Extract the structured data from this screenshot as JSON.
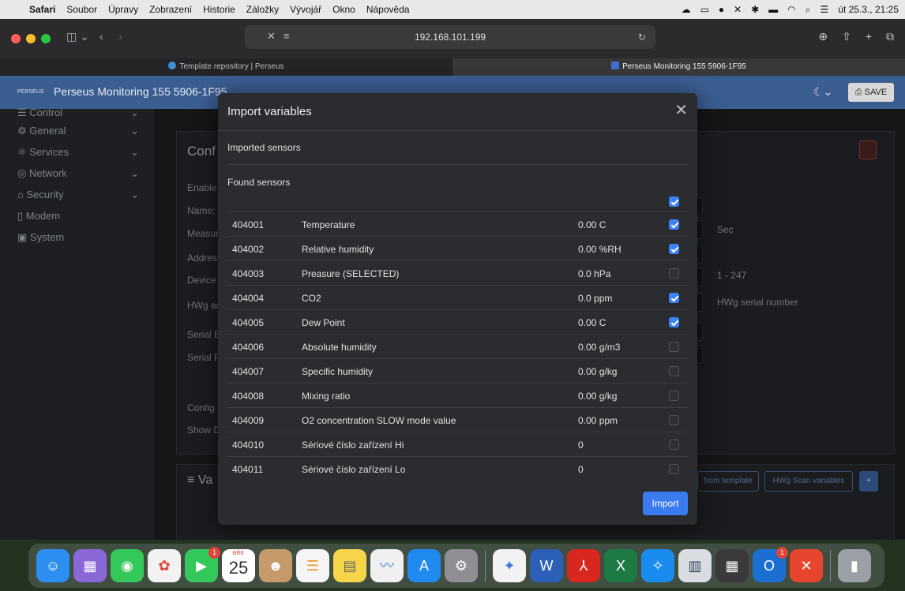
{
  "menubar": {
    "app": "Safari",
    "items": [
      "Soubor",
      "Úpravy",
      "Zobrazení",
      "Historie",
      "Záložky",
      "Vývojář",
      "Okno",
      "Nápověda"
    ],
    "datetime": "út 25.3., 21:25"
  },
  "browser": {
    "url": "192.168.101.199",
    "tabs": [
      {
        "label": "Template repository | Perseus"
      },
      {
        "label": "Perseus Monitoring 155 5906-1F95"
      }
    ]
  },
  "app": {
    "logo_text": "PERSEUS",
    "title": "Perseus Monitoring 155 5906-1F95",
    "save_label": "SAVE"
  },
  "sidebar": {
    "items": [
      {
        "label": "Control"
      },
      {
        "label": "General"
      },
      {
        "label": "Services"
      },
      {
        "label": "Network"
      },
      {
        "label": "Security"
      },
      {
        "label": "Modem"
      },
      {
        "label": "System"
      }
    ]
  },
  "background": {
    "config_heading": "Conf",
    "labels": [
      "Enable",
      "Name:",
      "Measur",
      "Addres",
      "Device",
      "HWg ad",
      "Serial B",
      "Serial P",
      "Config",
      "Show D"
    ],
    "hints": {
      "sec": "Sec",
      "range": "1 - 247",
      "hwg_serial": "HWg serial number"
    },
    "variables_heading": "Va",
    "from_template": "from template",
    "hwg_scan": "HWg Scan variables",
    "add": "+"
  },
  "modal": {
    "title": "Import variables",
    "imported_label": "Imported sensors",
    "found_label": "Found sensors",
    "select_all_checked": true,
    "import_label": "Import",
    "rows": [
      {
        "id": "404001",
        "name": "Temperature",
        "value": "0.00 C",
        "checked": true
      },
      {
        "id": "404002",
        "name": "Relative humidity",
        "value": "0.00 %RH",
        "checked": true
      },
      {
        "id": "404003",
        "name": "Preasure (SELECTED)",
        "value": "0.0 hPa",
        "checked": false
      },
      {
        "id": "404004",
        "name": "CO2",
        "value": "0.0 ppm",
        "checked": true
      },
      {
        "id": "404005",
        "name": "Dew Point",
        "value": "0.00 C",
        "checked": true
      },
      {
        "id": "404006",
        "name": "Absolute humidity",
        "value": "0.00 g/m3",
        "checked": false
      },
      {
        "id": "404007",
        "name": "Specific humidity",
        "value": "0.00 g/kg",
        "checked": false
      },
      {
        "id": "404008",
        "name": "Mixing ratio",
        "value": "0.00 g/kg",
        "checked": false
      },
      {
        "id": "404009",
        "name": "O2 concentration SLOW mode value",
        "value": "0.00 ppm",
        "checked": false
      },
      {
        "id": "404010",
        "name": "Sériové číslo zařízení Hi",
        "value": "0",
        "checked": false
      },
      {
        "id": "404011",
        "name": "Sériové číslo zařízení Lo",
        "value": "0",
        "checked": false
      }
    ]
  },
  "dock": {
    "calendar_month": "BŘE",
    "calendar_day": "25",
    "facetime_badge": "1",
    "outlook_badge": "1"
  }
}
